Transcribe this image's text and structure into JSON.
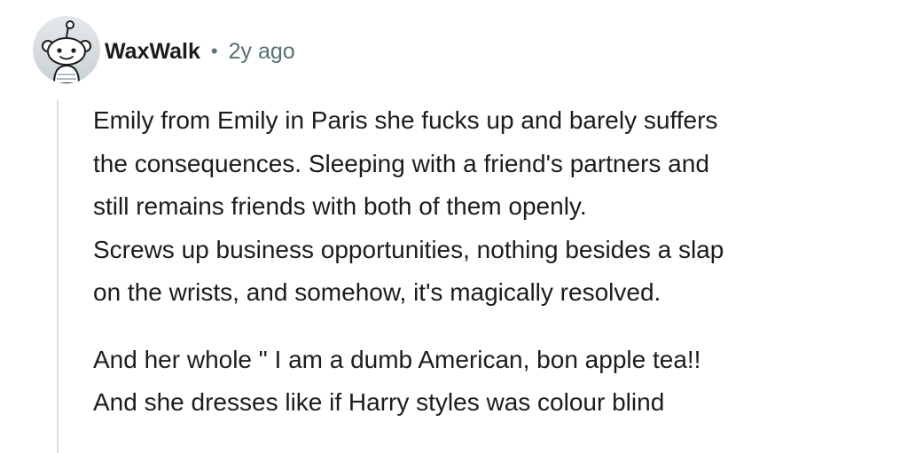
{
  "comment": {
    "avatar_icon": "reddit-snoo-avatar-icon",
    "username": "WaxWalk",
    "separator": "•",
    "timestamp": "2y ago",
    "paragraphs": [
      {
        "lines": [
          "Emily from Emily in Paris she fucks up and barely suffers",
          "the consequences. Sleeping with a friend's partners and",
          "still remains friends with both of them openly.",
          "Screws up business opportunities, nothing besides a slap",
          "on the wrists, and somehow, it's magically resolved."
        ]
      },
      {
        "lines": [
          "And her whole \" I am a dumb American, bon apple tea!!",
          "And she dresses like if Harry styles was colour blind"
        ]
      }
    ]
  },
  "colors": {
    "text": "#1c1c1c",
    "meta": "#576f76",
    "thread_line": "#d9e0e3",
    "avatar_bg": "#d7dde0"
  }
}
